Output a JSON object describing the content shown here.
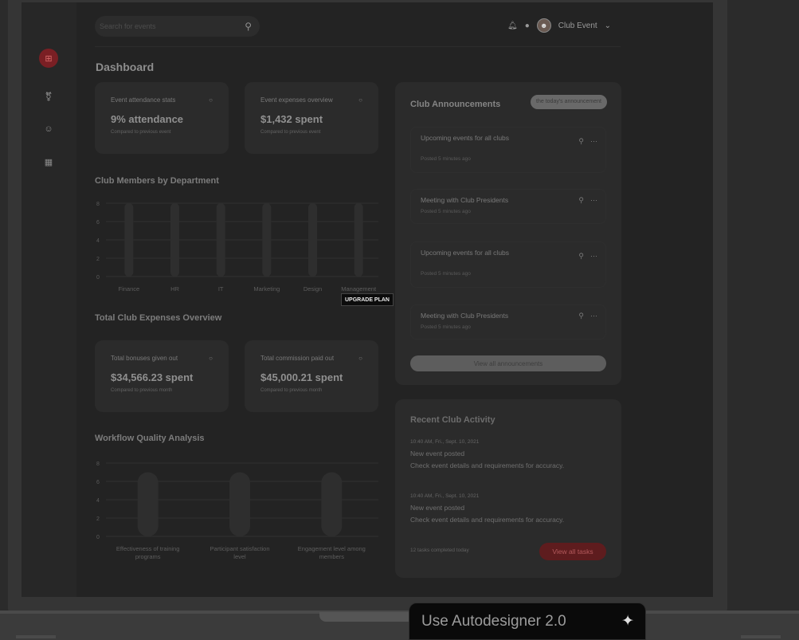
{
  "search": {
    "placeholder": "Search for events"
  },
  "topbar": {
    "user_name": "Club Event"
  },
  "page": {
    "title": "Dashboard"
  },
  "stats_top": [
    {
      "label": "Event attendance stats",
      "value": "9% attendance",
      "sub": "Compared to previous event"
    },
    {
      "label": "Event expenses overview",
      "value": "$1,432 spent",
      "sub": "Compared to previous event"
    }
  ],
  "members_chart_title": "Club Members by Department",
  "expenses_title": "Total Club Expenses Overview",
  "stats_bottom": [
    {
      "label": "Total bonuses given out",
      "value": "$34,566.23 spent",
      "sub": "Compared to previous month"
    },
    {
      "label": "Total commission paid out",
      "value": "$45,000.21 spent",
      "sub": "Compared to previous month"
    }
  ],
  "workflow_title": "Workflow Quality Analysis",
  "chart_data": [
    {
      "type": "bar",
      "title": "Club Members by Department",
      "categories": [
        "Finance",
        "HR",
        "IT",
        "Marketing",
        "Design",
        "Management"
      ],
      "values": [
        8,
        8,
        8,
        8,
        8,
        8
      ],
      "yticks": [
        0,
        2,
        4,
        6,
        8
      ],
      "ylim": [
        0,
        8
      ],
      "grid": true
    },
    {
      "type": "bar",
      "title": "Workflow Quality Analysis",
      "categories": [
        "Effectiveness of training programs",
        "Participant satisfaction level",
        "Engagement level among members"
      ],
      "values": [
        7,
        7,
        7
      ],
      "yticks": [
        0,
        2,
        4,
        6,
        8
      ],
      "ylim": [
        0,
        8
      ],
      "grid": true
    }
  ],
  "announcements": {
    "title": "Club Announcements",
    "filter_label": "the today's announcement",
    "items": [
      {
        "title": "Upcoming events for all clubs",
        "meta": "Posted 5 minutes ago"
      },
      {
        "title": "Meeting with Club Presidents",
        "meta": "Posted 5 minutes ago"
      },
      {
        "title": "Upcoming events for all clubs",
        "meta": "Posted 5 minutes ago"
      },
      {
        "title": "Meeting with Club Presidents",
        "meta": "Posted 5 minutes ago"
      }
    ],
    "view_all": "View all announcements"
  },
  "activity": {
    "title": "Recent Club Activity",
    "entries": [
      {
        "time": "10:40 AM, Fri., Sept. 10, 2021",
        "headline": "New event posted",
        "detail": "Check event details and requirements for accuracy."
      },
      {
        "time": "10:40 AM, Fri., Sept. 10, 2021",
        "headline": "New event posted",
        "detail": "Check event details and requirements for accuracy."
      }
    ],
    "footer": "12 tasks completed today",
    "view_tasks": "View all tasks"
  },
  "upgrade_label": "UPGRADE PLAN",
  "autodesigner_label": "Use Autodesigner 2.0",
  "icons": {
    "sidebar": [
      "dashboard-icon",
      "organization-icon",
      "members-icon",
      "calendar-icon"
    ],
    "topbar": [
      "bell-icon",
      "chat-icon",
      "avatar",
      "chevron-down-icon"
    ]
  }
}
